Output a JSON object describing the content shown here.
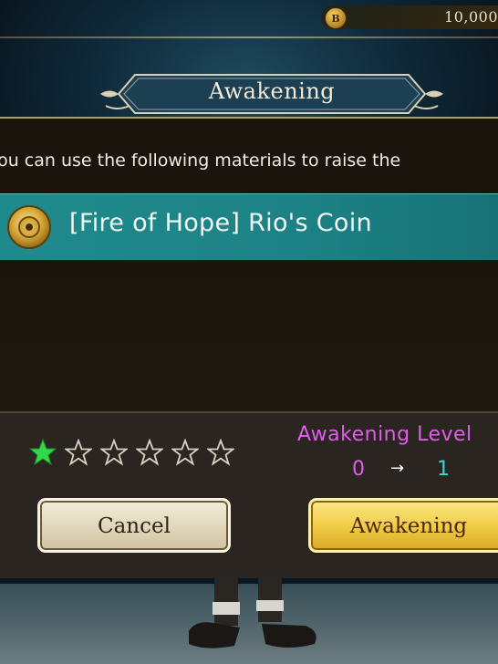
{
  "currency": {
    "icon": "coin-b-icon",
    "icon_letter": "B",
    "value": "10,000"
  },
  "dialog": {
    "title": "Awakening",
    "instruction": "You can use the following materials to raise the",
    "material": {
      "icon": "rio-coin-icon",
      "name": "[Fire of Hope] Rio's Coin"
    },
    "rarity": {
      "filled": 1,
      "total": 6,
      "filled_color": "#33d84a",
      "empty_color": "#d8d2c2"
    },
    "awakening_level": {
      "label": "Awakening Level",
      "from": "0",
      "arrow": "→",
      "to": "1"
    },
    "buttons": {
      "cancel": "Cancel",
      "confirm": "Awakening"
    }
  }
}
